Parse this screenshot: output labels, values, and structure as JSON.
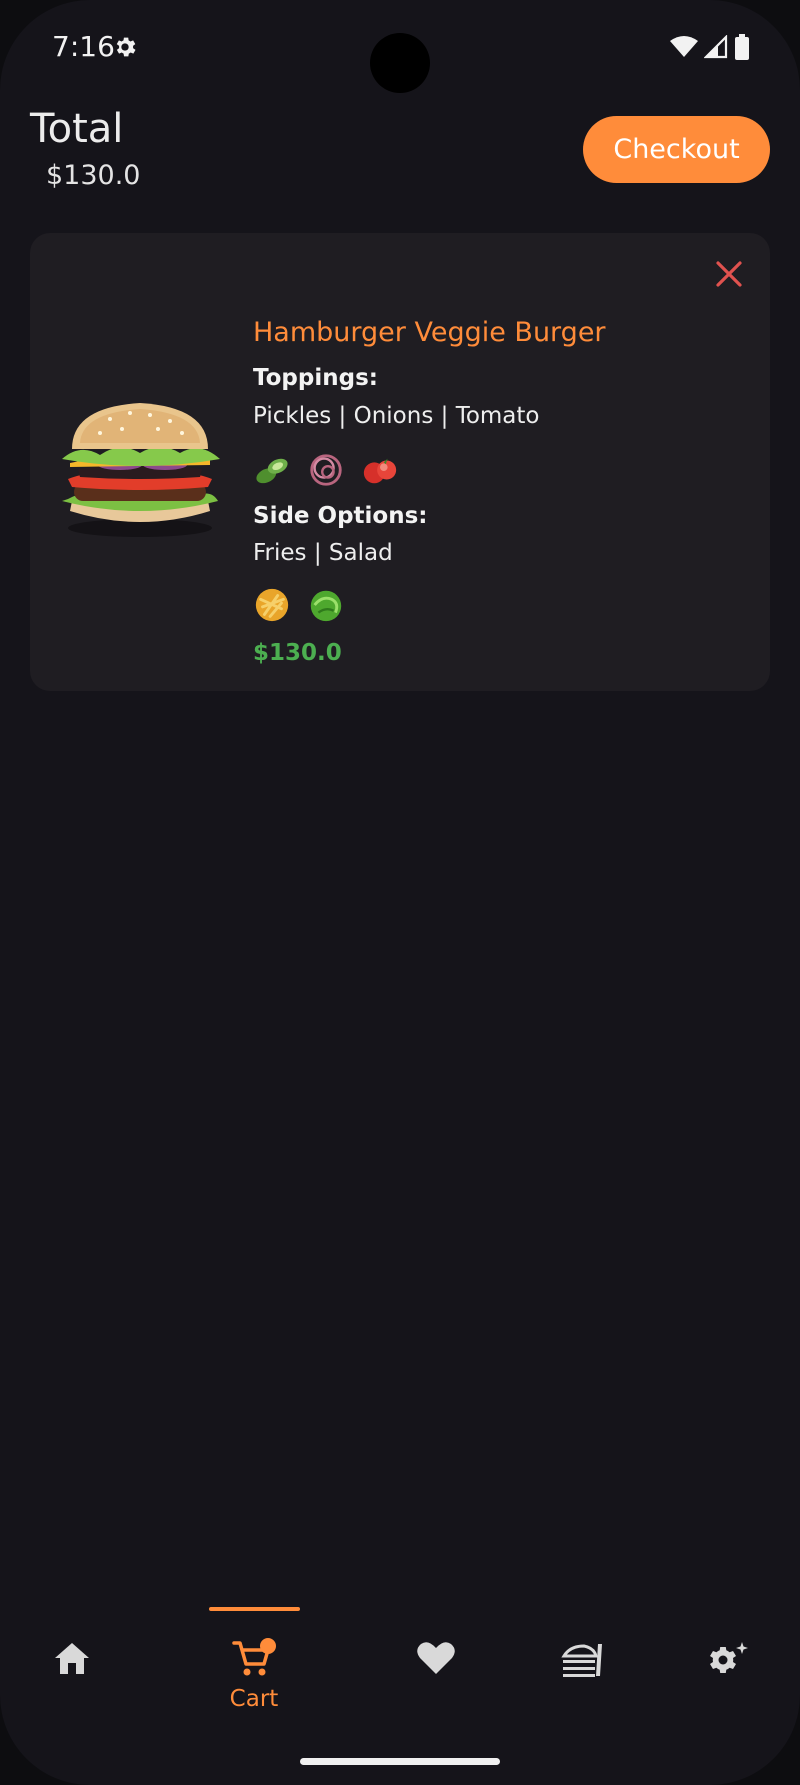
{
  "status_bar": {
    "time": "7:16"
  },
  "header": {
    "total_label": "Total",
    "total_value": "$130.0",
    "checkout_label": "Checkout"
  },
  "cart_item": {
    "title": "Hamburger Veggie Burger",
    "toppings_label": "Toppings:",
    "toppings_value": "Pickles | Onions | Tomato",
    "toppings_icons": [
      "pickles-icon",
      "onions-icon",
      "tomato-icon"
    ],
    "sides_label": "Side Options:",
    "sides_value": "Fries | Salad",
    "sides_icons": [
      "fries-icon",
      "salad-icon"
    ],
    "price": "$130.0"
  },
  "bottom_nav": {
    "items": [
      {
        "icon": "home-icon"
      },
      {
        "icon": "cart-icon",
        "label": "Cart",
        "selected": true
      },
      {
        "icon": "heart-icon"
      },
      {
        "icon": "orders-icon"
      },
      {
        "icon": "settings-icon"
      }
    ]
  },
  "colors": {
    "accent": "#ff8c3a",
    "price": "#4caf50",
    "remove": "#e0524f",
    "background": "#15141a",
    "card": "#1f1d22"
  }
}
